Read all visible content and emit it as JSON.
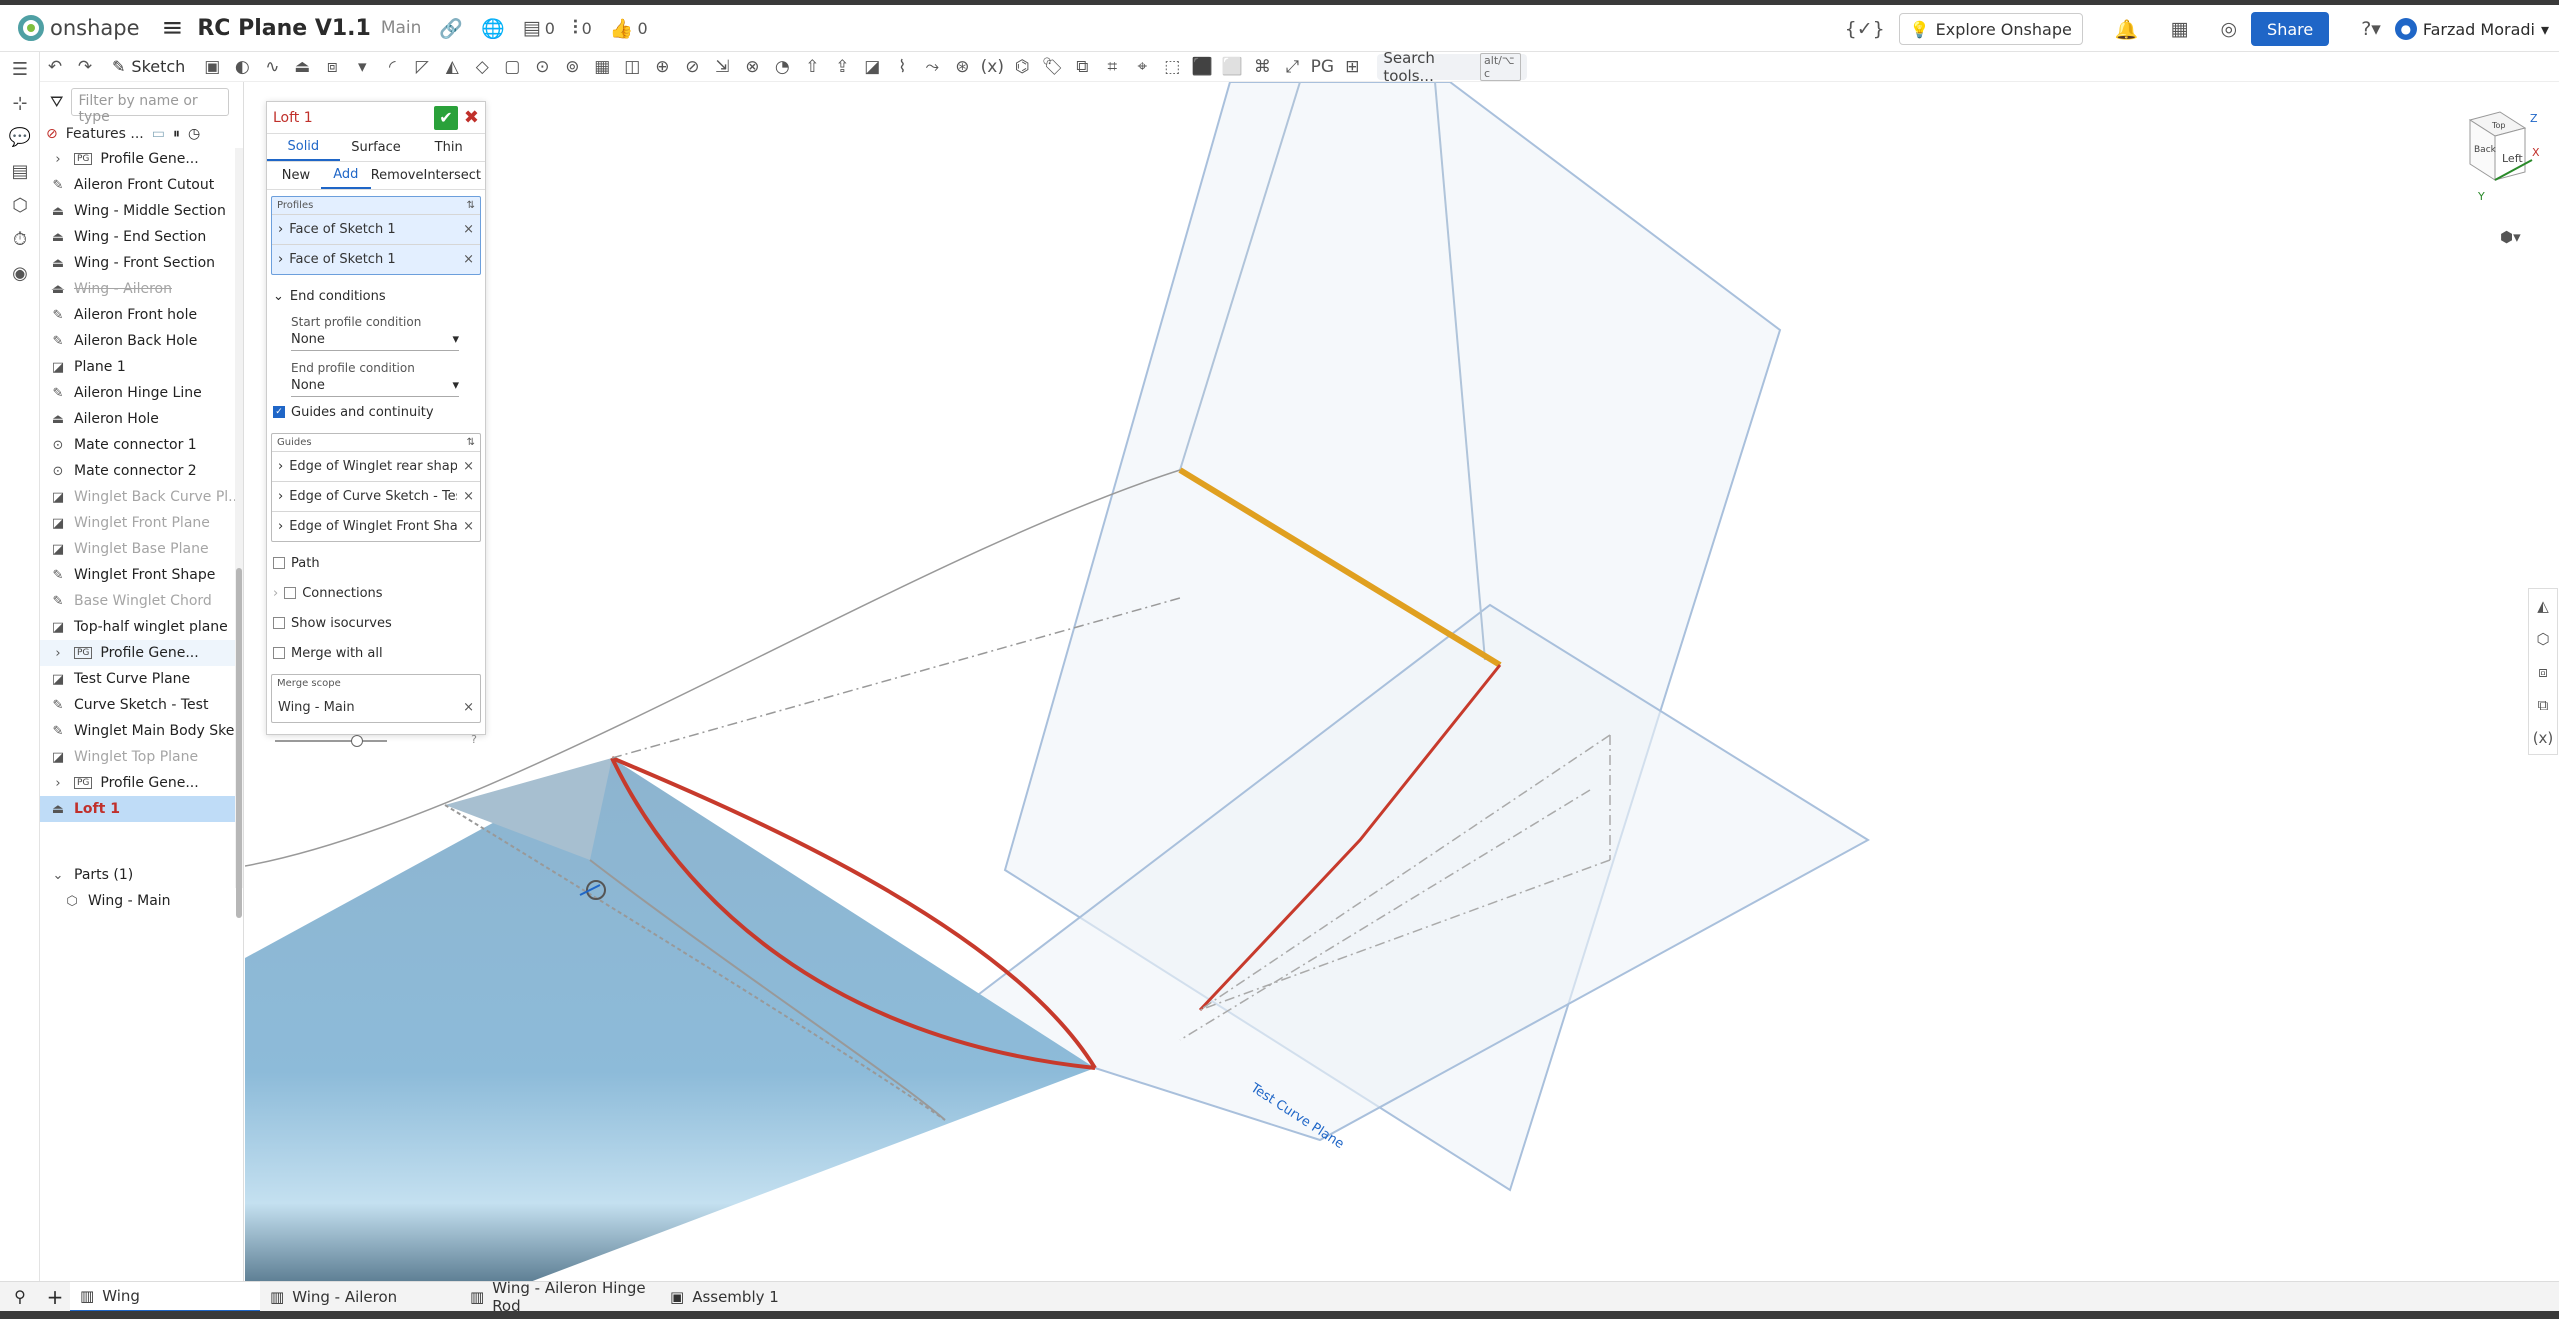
{
  "app": {
    "name": "onshape",
    "title": "RC Plane V1.1",
    "workspace": "Main",
    "counts": [
      "0",
      "0",
      "0"
    ]
  },
  "header": {
    "explore": "Explore Onshape",
    "share": "Share",
    "user": "Farzad Moradi"
  },
  "toolbar": {
    "sketch": "Sketch",
    "search": "Search tools...",
    "search_kbd": "alt/⌥ c"
  },
  "feature_tree": {
    "filter_placeholder": "Filter by name or type",
    "title": "Features ...",
    "items": [
      {
        "label": "Profile Gene...",
        "icon": "pg"
      },
      {
        "label": "Aileron Front Cutout",
        "icon": "sketch"
      },
      {
        "label": "Wing - Middle Section",
        "icon": "loft"
      },
      {
        "label": "Wing - End Section",
        "icon": "loft"
      },
      {
        "label": "Wing - Front Section",
        "icon": "loft"
      },
      {
        "label": "Wing - Aileron",
        "icon": "loft"
      },
      {
        "label": "Aileron Front hole",
        "icon": "sketch"
      },
      {
        "label": "Aileron Back Hole",
        "icon": "sketch"
      },
      {
        "label": "Plane 1",
        "icon": "plane"
      },
      {
        "label": "Aileron Hinge Line",
        "icon": "sketch"
      },
      {
        "label": "Aileron Hole",
        "icon": "loft"
      },
      {
        "label": "Mate connector 1",
        "icon": "mate"
      },
      {
        "label": "Mate connector 2",
        "icon": "mate"
      },
      {
        "label": "Winglet Back Curve Pl...",
        "icon": "plane"
      },
      {
        "label": "Winglet Front Plane",
        "icon": "plane"
      },
      {
        "label": "Winglet Base Plane",
        "icon": "plane"
      },
      {
        "label": "Winglet Front Shape",
        "icon": "sketch"
      },
      {
        "label": "Base Winglet Chord",
        "icon": "sketch"
      },
      {
        "label": "Top-half winglet plane",
        "icon": "plane"
      },
      {
        "label": "Profile Gene...",
        "icon": "pg"
      },
      {
        "label": "Test Curve Plane",
        "icon": "plane"
      },
      {
        "label": "Curve Sketch - Test",
        "icon": "sketch"
      },
      {
        "label": "Winglet Main Body Ske...",
        "icon": "sketch"
      },
      {
        "label": "Winglet Top Plane",
        "icon": "plane"
      },
      {
        "label": "Profile Gene...",
        "icon": "pg"
      },
      {
        "label": "Loft 1",
        "icon": "loft"
      }
    ],
    "parts_label": "Parts (1)",
    "part": "Wing - Main"
  },
  "loft": {
    "title": "Loft 1",
    "type_tabs": [
      "Solid",
      "Surface",
      "Thin"
    ],
    "op_tabs": [
      "New",
      "Add",
      "Remove",
      "Intersect"
    ],
    "profiles_label": "Profiles",
    "profiles": [
      "Face of Sketch 1",
      "Face of Sketch 1"
    ],
    "end_conditions": "End conditions",
    "start_label": "Start profile condition",
    "start_value": "None",
    "end_label": "End profile condition",
    "end_value": "None",
    "guides_toggle": "Guides and continuity",
    "guides_label": "Guides",
    "guides": [
      "Edge of Winglet rear shape",
      "Edge of Curve Sketch - Test",
      "Edge of Winglet Front Sha..."
    ],
    "path": "Path",
    "connections": "Connections",
    "isocurves": "Show isocurves",
    "merge_all": "Merge with all",
    "merge_scope_label": "Merge scope",
    "merge_scope": "Wing - Main"
  },
  "viewport": {
    "plane_label": "Test Curve Plane",
    "cube": {
      "front": "Left",
      "side": "Back",
      "top": "Top",
      "z": "Z",
      "x": "X",
      "y": "Y"
    }
  },
  "tabs": [
    "Wing",
    "Wing - Aileron",
    "Wing - Aileron Hinge Rod",
    "Assembly 1"
  ]
}
